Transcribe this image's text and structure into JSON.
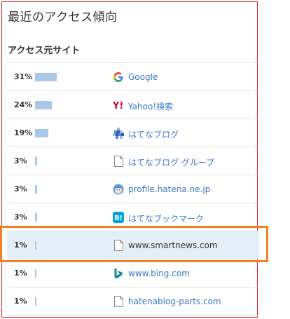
{
  "panel_title": "最近のアクセス傾向",
  "section_title": "アクセス元サイト",
  "rows": [
    {
      "percent_label": "31%",
      "percent": 31,
      "icon": "google-icon",
      "site": "Google"
    },
    {
      "percent_label": "24%",
      "percent": 24,
      "icon": "yahoo-icon",
      "site": "Yahoo!検索"
    },
    {
      "percent_label": "19%",
      "percent": 19,
      "icon": "hatena-blog-icon",
      "site": "はてなブログ"
    },
    {
      "percent_label": "3%",
      "percent": 3,
      "icon": "document-icon",
      "site": "はてなブログ グループ"
    },
    {
      "percent_label": "3%",
      "percent": 3,
      "icon": "profile-avatar-icon",
      "site": "profile.hatena.ne.jp"
    },
    {
      "percent_label": "3%",
      "percent": 3,
      "icon": "hatena-bookmark-icon",
      "site": "はてなブックマーク"
    },
    {
      "percent_label": "1%",
      "percent": 1,
      "icon": "document-icon",
      "site": "www.smartnews.com"
    },
    {
      "percent_label": "1%",
      "percent": 1,
      "icon": "bing-icon",
      "site": "www.bing.com"
    },
    {
      "percent_label": "1%",
      "percent": 1,
      "icon": "document-icon",
      "site": "hatenablog-parts.com"
    }
  ],
  "colors": {
    "bar": "#a9c8e8",
    "link": "#3a78c9",
    "highlight_row": "#e4eef6",
    "highlight_frame": "#f0812a",
    "panel_border": "#e02020"
  }
}
